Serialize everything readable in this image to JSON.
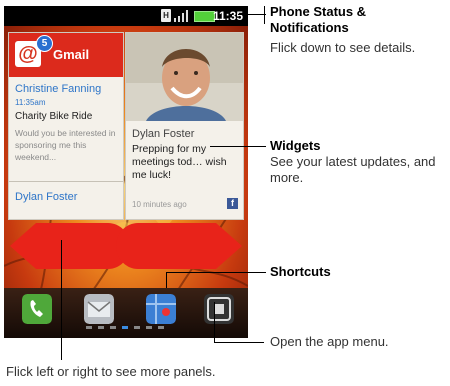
{
  "status_bar": {
    "time": "11:35",
    "sim_glyph": "H"
  },
  "gmail_widget": {
    "title": "Gmail",
    "unread_badge": "5",
    "sender": "Christine Fanning",
    "time": "11:35am",
    "subject": "Charity Bike Ride",
    "preview": "Would you be interested in sponsoring me this weekend...",
    "next_sender": "Dylan Foster"
  },
  "social_widget": {
    "name": "Dylan Foster",
    "status": "Prepping for my meetings tod… wish me luck!",
    "time": "10 minutes ago",
    "network_glyph": "f"
  },
  "callouts": {
    "status_title": "Phone Status & Notifications",
    "status_desc": "Flick down to see details.",
    "widgets_title": "Widgets",
    "widgets_desc": "See your latest updates, and more.",
    "shortcuts_title": "Shortcuts",
    "app_menu_desc": "Open the app menu.",
    "panels_desc": "Flick left or right to see more panels."
  },
  "colors": {
    "gmail_red": "#dc2a1c",
    "link_blue": "#2e75c8",
    "battery_green": "#53d13a"
  },
  "icons": [
    "signal-icon",
    "battery-icon",
    "sim-icon",
    "phone-icon",
    "mail-icon",
    "maps-icon",
    "app-menu-icon",
    "facebook-icon"
  ]
}
